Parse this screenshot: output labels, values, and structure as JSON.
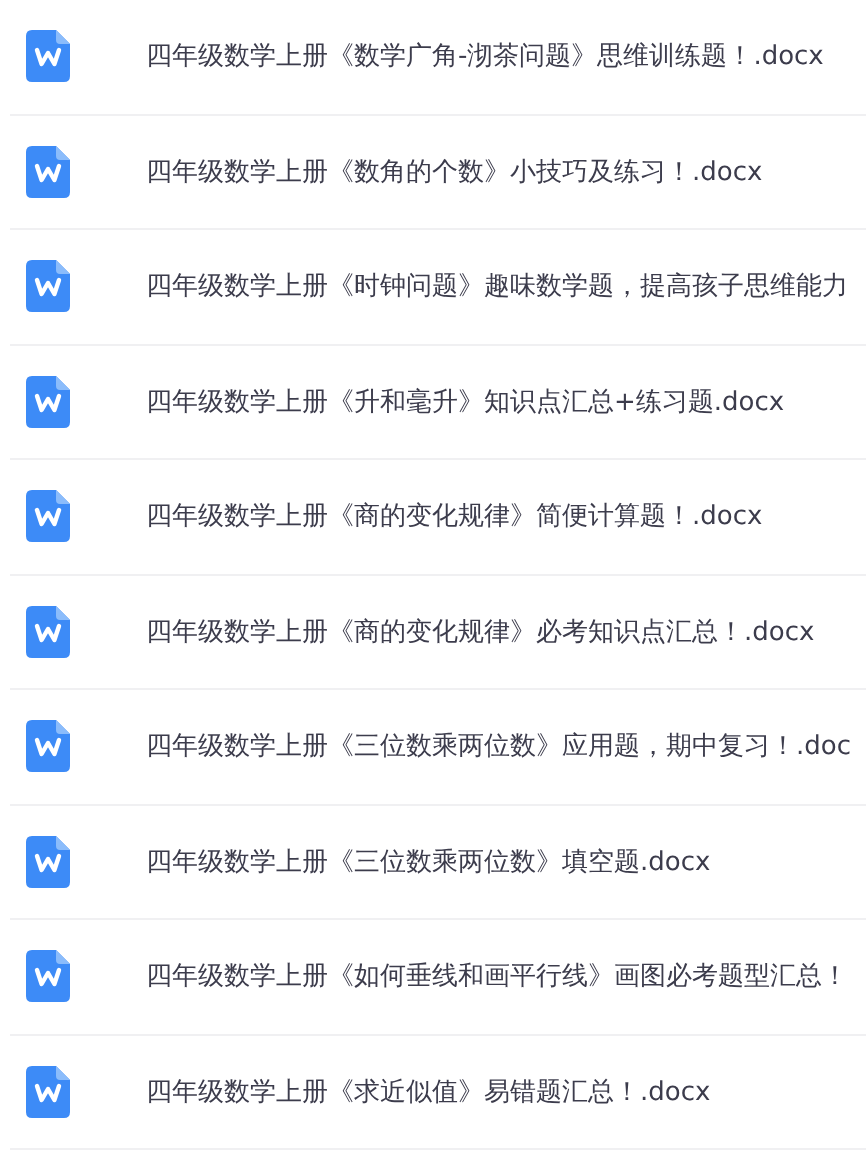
{
  "files": [
    {
      "name": "四年级数学上册《数学广角-沏茶问题》思维训练题！.docx"
    },
    {
      "name": "四年级数学上册《数角的个数》小技巧及练习！.docx"
    },
    {
      "name": "四年级数学上册《时钟问题》趣味数学题，提高孩子思维能力"
    },
    {
      "name": "四年级数学上册《升和毫升》知识点汇总+练习题.docx"
    },
    {
      "name": "四年级数学上册《商的变化规律》简便计算题！.docx"
    },
    {
      "name": "四年级数学上册《商的变化规律》必考知识点汇总！.docx"
    },
    {
      "name": "四年级数学上册《三位数乘两位数》应用题，期中复习！.doc"
    },
    {
      "name": "四年级数学上册《三位数乘两位数》填空题.docx"
    },
    {
      "name": "四年级数学上册《如何垂线和画平行线》画图必考题型汇总！"
    },
    {
      "name": "四年级数学上册《求近似值》易错题汇总！.docx"
    }
  ]
}
